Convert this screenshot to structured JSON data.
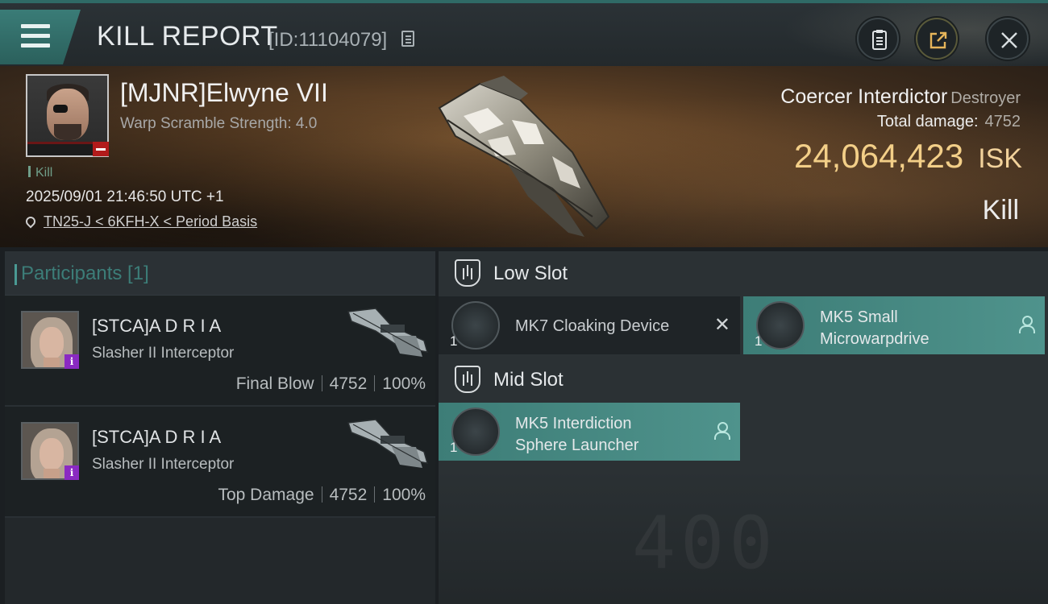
{
  "header": {
    "title": "KILL REPORT",
    "report_id": "[ID:11104079]"
  },
  "victim": {
    "name": "[MJNR]Elwyne VII",
    "warp_scramble": "Warp Scramble Strength: 4.0",
    "kill_tag": "Kill",
    "timestamp": "2025/09/01 21:46:50 UTC +1",
    "location": "TN25-J < 6KFH-X < Period Basis"
  },
  "ship": {
    "name": "Coercer Interdictor",
    "class": "Destroyer",
    "total_damage_label": "Total damage:",
    "total_damage_value": "4752",
    "isk_value": "24,064,423",
    "isk_unit": "ISK",
    "result": "Kill"
  },
  "participants": {
    "title": "Participants [1]",
    "rows": [
      {
        "name": "[STCA]A D R I A",
        "ship": "Slasher II Interceptor",
        "role": "Final Blow",
        "damage": "4752",
        "percent": "100%"
      },
      {
        "name": "[STCA]A D R I A",
        "ship": "Slasher II Interceptor",
        "role": "Top Damage",
        "damage": "4752",
        "percent": "100%"
      }
    ]
  },
  "slots": {
    "low": {
      "label": "Low Slot",
      "modules": [
        {
          "name_line1": "MK7 Cloaking Device",
          "name_line2": "",
          "qty": "1",
          "state": "destroyed"
        },
        {
          "name_line1": "MK5 Small",
          "name_line2": "Microwarpdrive",
          "qty": "1",
          "state": "dropped"
        }
      ]
    },
    "mid": {
      "label": "Mid Slot",
      "modules": [
        {
          "name_line1": "MK5 Interdiction",
          "name_line2": "Sphere Launcher",
          "qty": "1",
          "state": "dropped"
        }
      ]
    }
  },
  "icons": {
    "menu": "hamburger-icon",
    "copy": "copy-icon",
    "clipboard": "clipboard-icon",
    "share": "share-icon",
    "close": "close-icon",
    "location": "location-pin-icon",
    "slot": "slot-shield-icon",
    "owner": "person-icon",
    "destroyed": "x-icon"
  },
  "colors": {
    "accent": "#3d7d77",
    "isk": "#f3cf88",
    "kill_tag": "#6f9e89",
    "victim_badge": "#b21b1b",
    "info_badge": "#8a2ac2"
  }
}
